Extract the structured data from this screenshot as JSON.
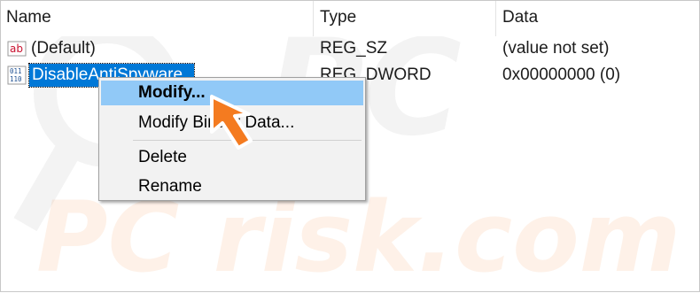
{
  "columns": {
    "name": "Name",
    "type": "Type",
    "data": "Data"
  },
  "rows": [
    {
      "icon": "string-value-icon",
      "icon_text": "ab",
      "name": "(Default)",
      "type": "REG_SZ",
      "data": "(value not set)"
    },
    {
      "icon": "binary-value-icon",
      "icon_text_top": "011",
      "icon_text_bottom": "110",
      "name": "DisableAntiSpyware",
      "type": "REG_DWORD",
      "data": "0x00000000 (0)"
    }
  ],
  "context_menu": {
    "items": [
      {
        "label": "Modify...",
        "highlighted": true
      },
      {
        "label": "Modify Binary Data..."
      },
      {
        "label": "Delete"
      },
      {
        "label": "Rename"
      }
    ]
  },
  "watermark": "PC risk.com",
  "colors": {
    "selection": "#0078d7",
    "menu_highlight": "#91c9f7",
    "arrow": "#f47b20"
  }
}
